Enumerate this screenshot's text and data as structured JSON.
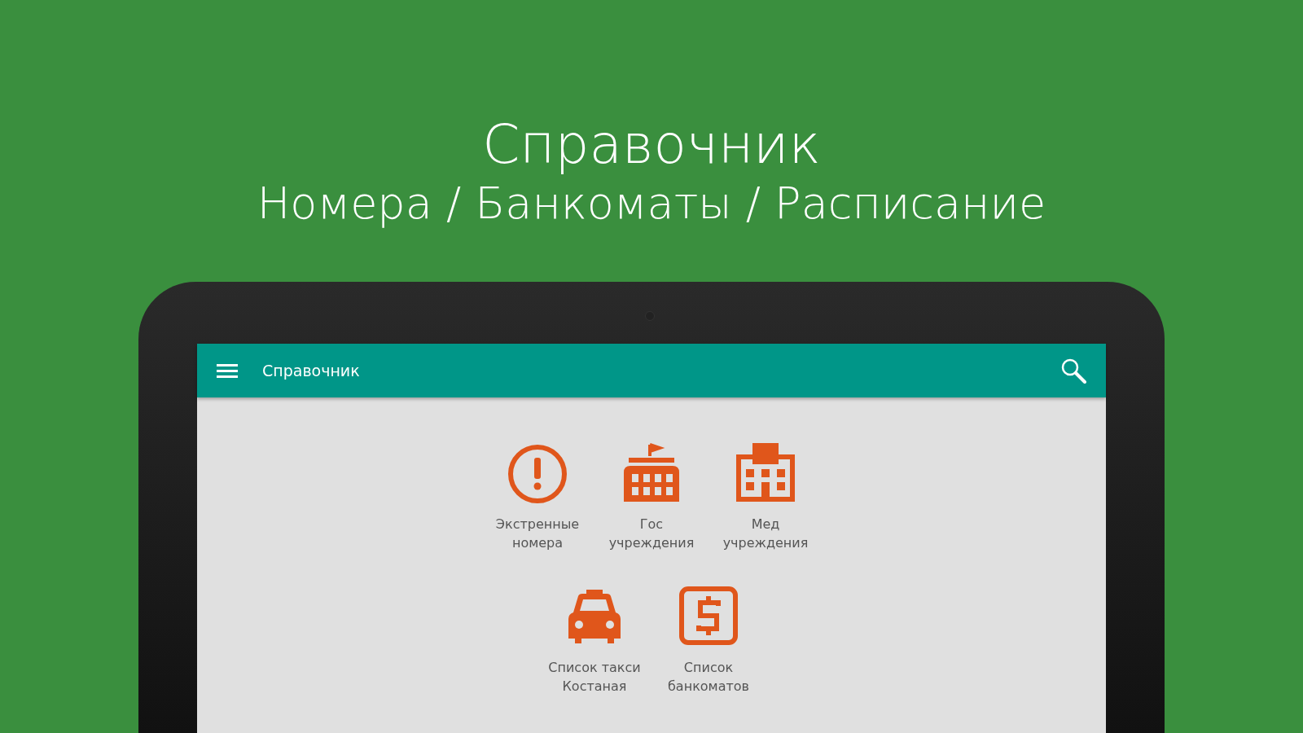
{
  "headline": {
    "title": "Справочник",
    "subtitle": "Номера / Банкоматы / Расписание"
  },
  "app_bar": {
    "title": "Справочник"
  },
  "rows": [
    {
      "items": [
        {
          "kind": "alert",
          "label": "Экстренные\nномера"
        },
        {
          "kind": "government",
          "label": "Гос\nучреждения"
        },
        {
          "kind": "hospital",
          "label": "Мед\nучреждения"
        }
      ]
    },
    {
      "items": [
        {
          "kind": "taxi",
          "label": "Список такси\nКостаная"
        },
        {
          "kind": "money",
          "label": "Список\nбанкоматов"
        }
      ]
    }
  ]
}
